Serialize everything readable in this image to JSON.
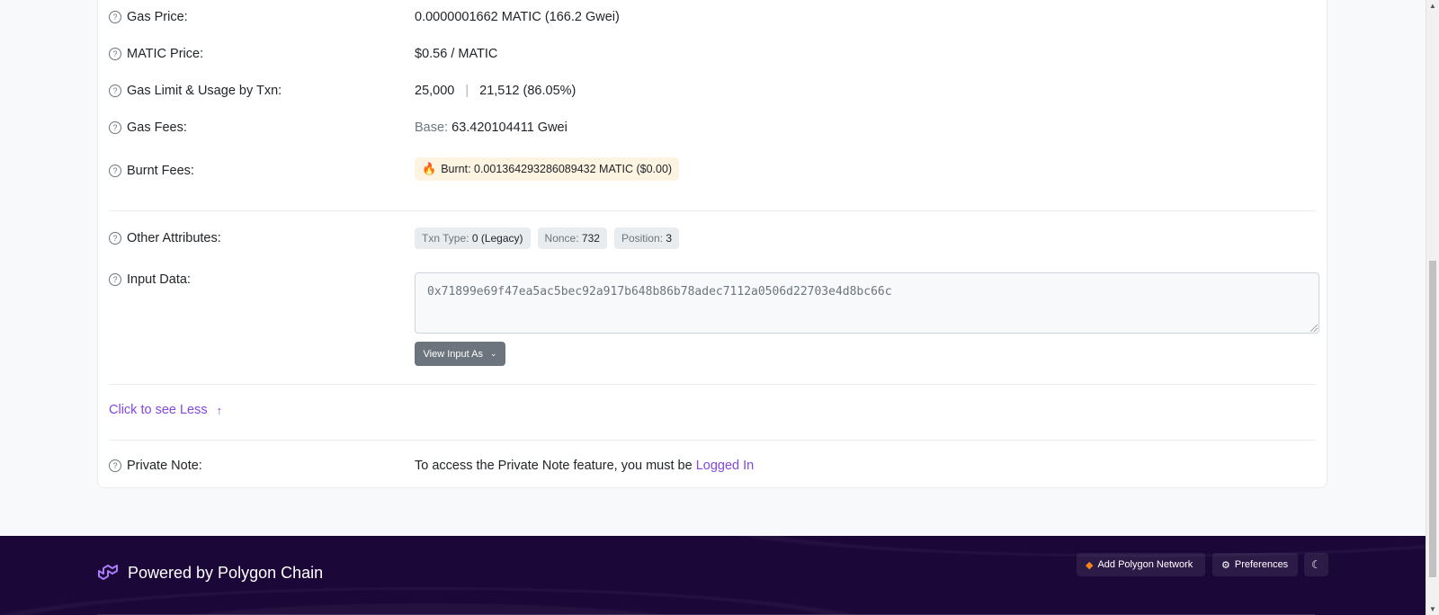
{
  "rows": {
    "gas_price": {
      "label": "Gas Price:",
      "value": "0.0000001662 MATIC (166.2 Gwei)"
    },
    "matic_price": {
      "label": "MATIC Price:",
      "value": "$0.56 / MATIC"
    },
    "gas_limit": {
      "label": "Gas Limit & Usage by Txn:",
      "limit": "25,000",
      "separator": "|",
      "usage": "21,512 (86.05%)"
    },
    "gas_fees": {
      "label": "Gas Fees:",
      "base_label": "Base:",
      "base_value": "63.420104411 Gwei"
    },
    "burnt_fees": {
      "label": "Burnt Fees:",
      "text": "Burnt: 0.001364293286089432 MATIC ($0.00)"
    },
    "other_attributes": {
      "label": "Other Attributes:",
      "badges": [
        {
          "key": "Txn Type:",
          "value": "0 (Legacy)"
        },
        {
          "key": "Nonce:",
          "value": "732"
        },
        {
          "key": "Position:",
          "value": "3"
        }
      ]
    },
    "input_data": {
      "label": "Input Data:",
      "value": "0x71899e69f47ea5ac5bec92a917b648b86b78adec7112a0506d22703e4d8bc66c",
      "view_button": "View Input As"
    },
    "private_note": {
      "label": "Private Note:",
      "text": "To access the Private Note feature, you must be",
      "link": "Logged In"
    }
  },
  "see_less": {
    "label": "Click to see Less"
  },
  "footer": {
    "brand": "Powered by Polygon Chain",
    "add_network": "Add Polygon Network",
    "preferences": "Preferences"
  },
  "colors": {
    "accent": "#8247e5",
    "footer_bg": "#1b0738"
  }
}
